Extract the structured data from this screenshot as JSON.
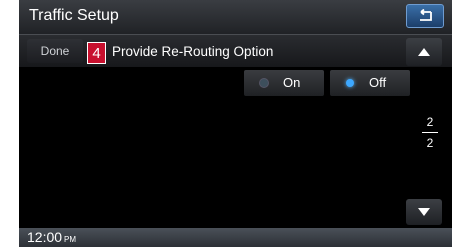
{
  "header": {
    "title": "Traffic Setup"
  },
  "row": {
    "done_label": "Done",
    "step_number": "4",
    "option_label": "Provide Re-Routing Option"
  },
  "options": [
    {
      "label": "On",
      "selected": false
    },
    {
      "label": "Off",
      "selected": true
    }
  ],
  "pager": {
    "current": "2",
    "total": "2"
  },
  "status": {
    "time": "12:00",
    "ampm": "PM"
  },
  "colors": {
    "accent": "#3da8ff",
    "badge": "#c8102e",
    "back_button": "#2a5a94"
  }
}
